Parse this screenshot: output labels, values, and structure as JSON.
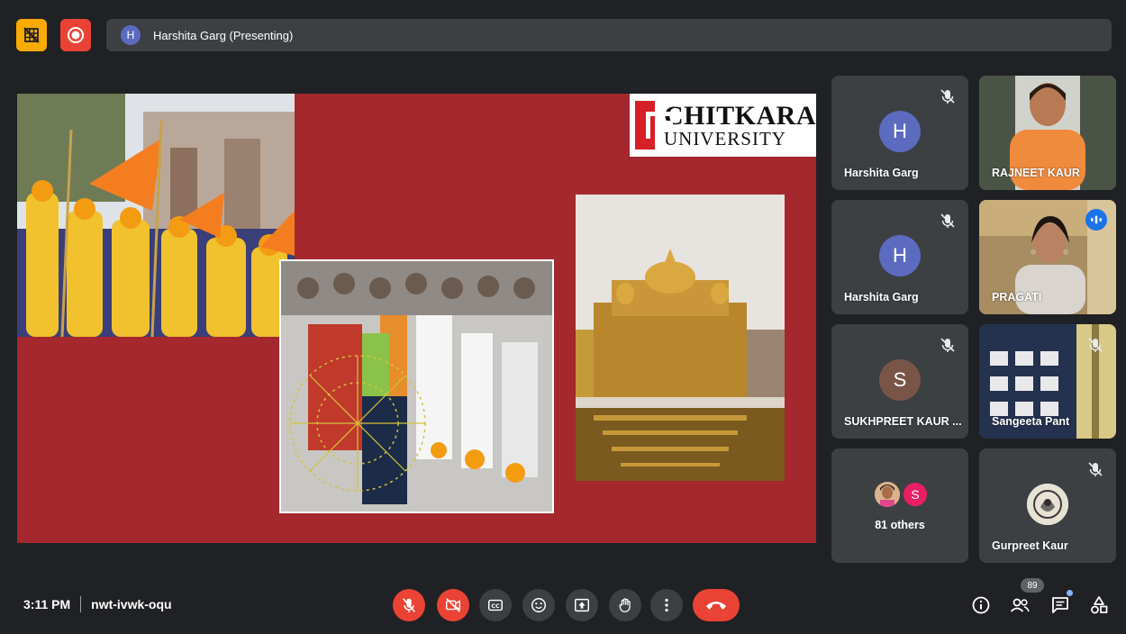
{
  "top_bar": {
    "presenter_initial": "H",
    "presenter_label": "Harshita Garg (Presenting)"
  },
  "slide": {
    "logo_line1": "CHITKARA",
    "logo_line2": "UNIVERSITY"
  },
  "participants": [
    {
      "name": "Harshita Garg",
      "initial": "H",
      "avatar_color": "#5c6bc0",
      "muted": true
    },
    {
      "name": "RAJNEET KAUR",
      "video": true,
      "muted": false
    },
    {
      "name": "Harshita Garg",
      "initial": "H",
      "avatar_color": "#5c6bc0",
      "muted": true
    },
    {
      "name": "PRAGATI",
      "video": true,
      "speaking": true
    },
    {
      "name": "SUKHPREET KAUR ...",
      "initial": "S",
      "avatar_color": "#795548",
      "muted": true
    },
    {
      "name": "Sangeeta Pant",
      "video": true,
      "muted": true
    },
    {
      "others_label": "81 others",
      "others_initial": "S",
      "others_color": "#e91e63"
    },
    {
      "name": "Gurpreet Kaur",
      "muted": true
    }
  ],
  "bottom_bar": {
    "time": "3:11 PM",
    "meeting_code": "nwt-ivwk-oqu",
    "people_count": "89"
  },
  "colors": {
    "background": "#202124",
    "surface": "#3c4043",
    "danger": "#ea4335",
    "accent": "#1a73e8",
    "slide_red": "#a4282d"
  }
}
